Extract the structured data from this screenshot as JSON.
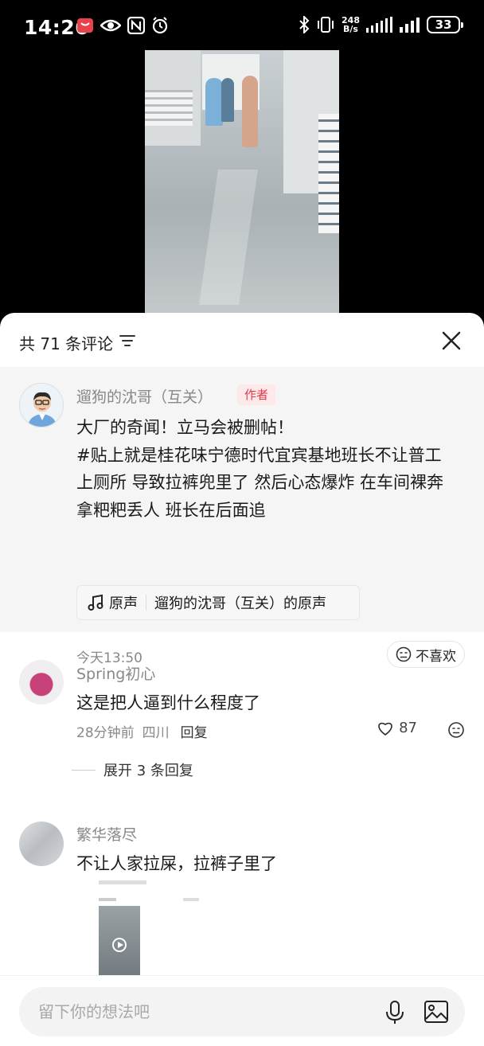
{
  "status_bar": {
    "time": "14:26",
    "net_speed_value": "248",
    "net_speed_unit": "B/s",
    "battery": "33"
  },
  "panel": {
    "title": "共 71 条评论",
    "close_icon": "close-icon",
    "filter_icon": "filter-icon"
  },
  "pinned": {
    "username": "遛狗的沈哥（互关）",
    "author_tag": "作者",
    "text_lines": [
      "大厂的奇闻！立马会被删帖！",
      "#贴上就是桂花味宁德时代宜宾基地班长不让普工",
      "上厕所 导致拉裤兜里了 然后心态爆炸 在车间裸奔",
      "拿粑粑丢人 班长在后面追"
    ],
    "sound_label": "原声",
    "sound_title": "遛狗的沈哥（互关）的原声",
    "time": "今天13:50",
    "dislike_label": "不喜欢"
  },
  "comments": [
    {
      "username": "Spring初心",
      "text": "这是把人逼到什么程度了",
      "time": "28分钟前",
      "location": "四川",
      "reply_label": "回复",
      "likes": "87",
      "expand_label": "展开 3 条回复"
    },
    {
      "username": "繁华落尽",
      "text": "不让人家拉屎，拉裤子里了"
    }
  ],
  "input": {
    "placeholder": "留下你的想法吧"
  },
  "colors": {
    "author_tag_bg": "#fde8ea",
    "author_tag_text": "#e33a4b",
    "pinned_bg": "#f5f5f5"
  }
}
